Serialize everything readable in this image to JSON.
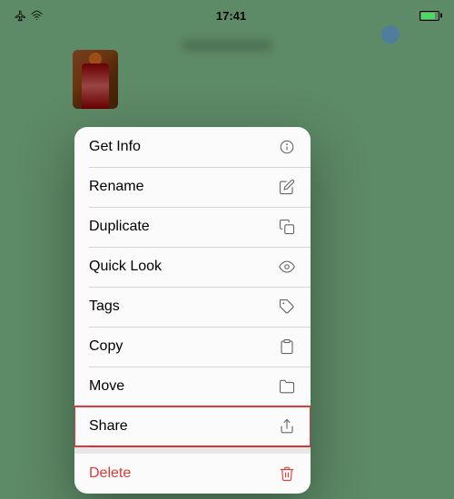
{
  "statusBar": {
    "time": "17:41",
    "batteryPercent": 85
  },
  "contextMenu": {
    "items": [
      {
        "id": "get-info",
        "label": "Get Info",
        "icon": "info"
      },
      {
        "id": "rename",
        "label": "Rename",
        "icon": "pencil"
      },
      {
        "id": "duplicate",
        "label": "Duplicate",
        "icon": "duplicate"
      },
      {
        "id": "quick-look",
        "label": "Quick Look",
        "icon": "eye"
      },
      {
        "id": "tags",
        "label": "Tags",
        "icon": "tag"
      },
      {
        "id": "copy",
        "label": "Copy",
        "icon": "copy"
      },
      {
        "id": "move",
        "label": "Move",
        "icon": "folder"
      },
      {
        "id": "share",
        "label": "Share",
        "icon": "share",
        "highlighted": true
      }
    ],
    "deleteLabel": "Delete"
  }
}
